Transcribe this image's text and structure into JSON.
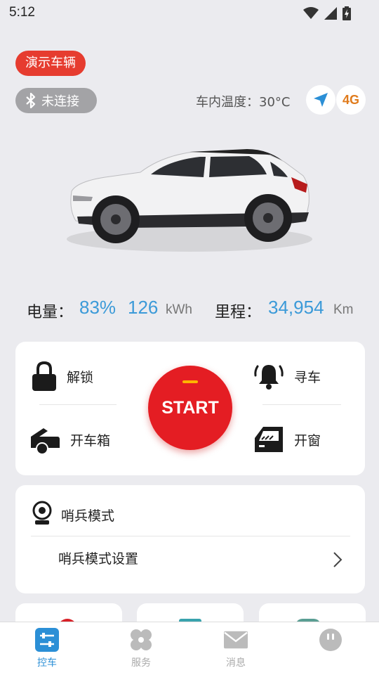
{
  "status_bar": {
    "time": "5:12",
    "icons": [
      "wifi-icon",
      "signal-icon",
      "battery-icon"
    ]
  },
  "vehicle": {
    "demo_label": "演示车辆",
    "bluetooth_label": "未连接",
    "temperature_label": "车内温度：30°C",
    "connectivity_badge": "4G"
  },
  "stats": {
    "battery_label": "电量：",
    "battery_percent": "83%",
    "battery_energy": "126",
    "battery_unit": "kWh",
    "mileage_label": "里程：",
    "mileage_value": "34,954",
    "mileage_unit": "Km"
  },
  "controls": {
    "unlock": "解锁",
    "find_car": "寻车",
    "open_trunk": "开车箱",
    "open_window": "开窗",
    "start": "START"
  },
  "sentry": {
    "title": "哨兵模式",
    "settings": "哨兵模式设置"
  },
  "tabs": [
    {
      "label": "控车",
      "icon": "car-control-icon",
      "active": true
    },
    {
      "label": "服务",
      "icon": "services-icon",
      "active": false
    },
    {
      "label": "消息",
      "icon": "mail-icon",
      "active": false
    },
    {
      "label": "",
      "icon": "profile-icon",
      "active": false
    }
  ],
  "colors": {
    "accent": "#2b8fd6",
    "start": "#e41d23",
    "demo_badge": "#e63c2f",
    "value_blue": "#3b9ad8"
  }
}
